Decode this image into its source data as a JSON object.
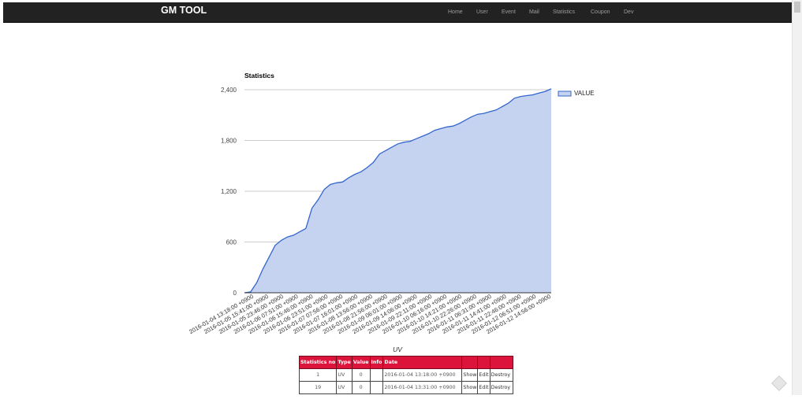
{
  "navbar": {
    "brand": "GM TOOL",
    "links": [
      "Home",
      "User",
      "Event",
      "Mail",
      "Statistics",
      "Coupon",
      "Dev"
    ]
  },
  "chart_data": {
    "type": "area",
    "title": "Statistics",
    "xlabel": "UV",
    "ylabel": "",
    "ylim": [
      0,
      2400
    ],
    "yticks": [
      "0",
      "600",
      "1,200",
      "1,800",
      "2,400"
    ],
    "grid": true,
    "legend_position": "right",
    "colors": {
      "fill": "#c5d3f0",
      "line": "#3366cc"
    },
    "x_tick_labels": [
      "2016-01-04 13:18:00 +0900",
      "2016-01-05 15:41:00 +0900",
      "2016-01-05 23:46:00 +0900",
      "2016-01-06 07:51:00 +0900",
      "2016-01-06 15:46:00 +0900",
      "2016-01-06 23:51:00 +0900",
      "2016-01-07 07:56:00 +0900",
      "2016-01-07 16:01:00 +0900",
      "2016-01-08 13:56:00 +0900",
      "2016-01-08 21:56:00 +0900",
      "2016-01-09 06:01:00 +0900",
      "2016-01-09 14:06:00 +0900",
      "2016-01-09 22:11:00 +0900",
      "2016-01-10 06:16:00 +0900",
      "2016-01-10 14:21:00 +0900",
      "2016-01-10 22:26:00 +0900",
      "2016-01-11 06:31:00 +0900",
      "2016-01-11 14:41:00 +0900",
      "2016-01-11 22:46:00 +0900",
      "2016-01-12 06:51:00 +0900",
      "2016-01-12 14:56:00 +0900"
    ],
    "series": [
      {
        "name": "VALUE",
        "values": [
          0,
          10,
          120,
          280,
          420,
          560,
          620,
          660,
          680,
          720,
          760,
          1000,
          1100,
          1220,
          1280,
          1300,
          1310,
          1360,
          1400,
          1430,
          1480,
          1540,
          1640,
          1680,
          1720,
          1760,
          1780,
          1790,
          1820,
          1850,
          1880,
          1920,
          1940,
          1960,
          1970,
          2000,
          2040,
          2080,
          2110,
          2120,
          2140,
          2160,
          2200,
          2240,
          2300,
          2320,
          2330,
          2340,
          2360,
          2380,
          2410
        ]
      }
    ]
  },
  "table": {
    "headers": [
      "Statistics no",
      "Type",
      "Value",
      "Info",
      "Date",
      "",
      "",
      ""
    ],
    "rows": [
      [
        "1",
        "UV",
        "0",
        "",
        "2016-01-04 13:18:00 +0900",
        "Show",
        "Edit",
        "Destroy"
      ],
      [
        "19",
        "UV",
        "0",
        "",
        "2016-01-04 13:31:00 +0900",
        "Show",
        "Edit",
        "Destroy"
      ]
    ]
  }
}
